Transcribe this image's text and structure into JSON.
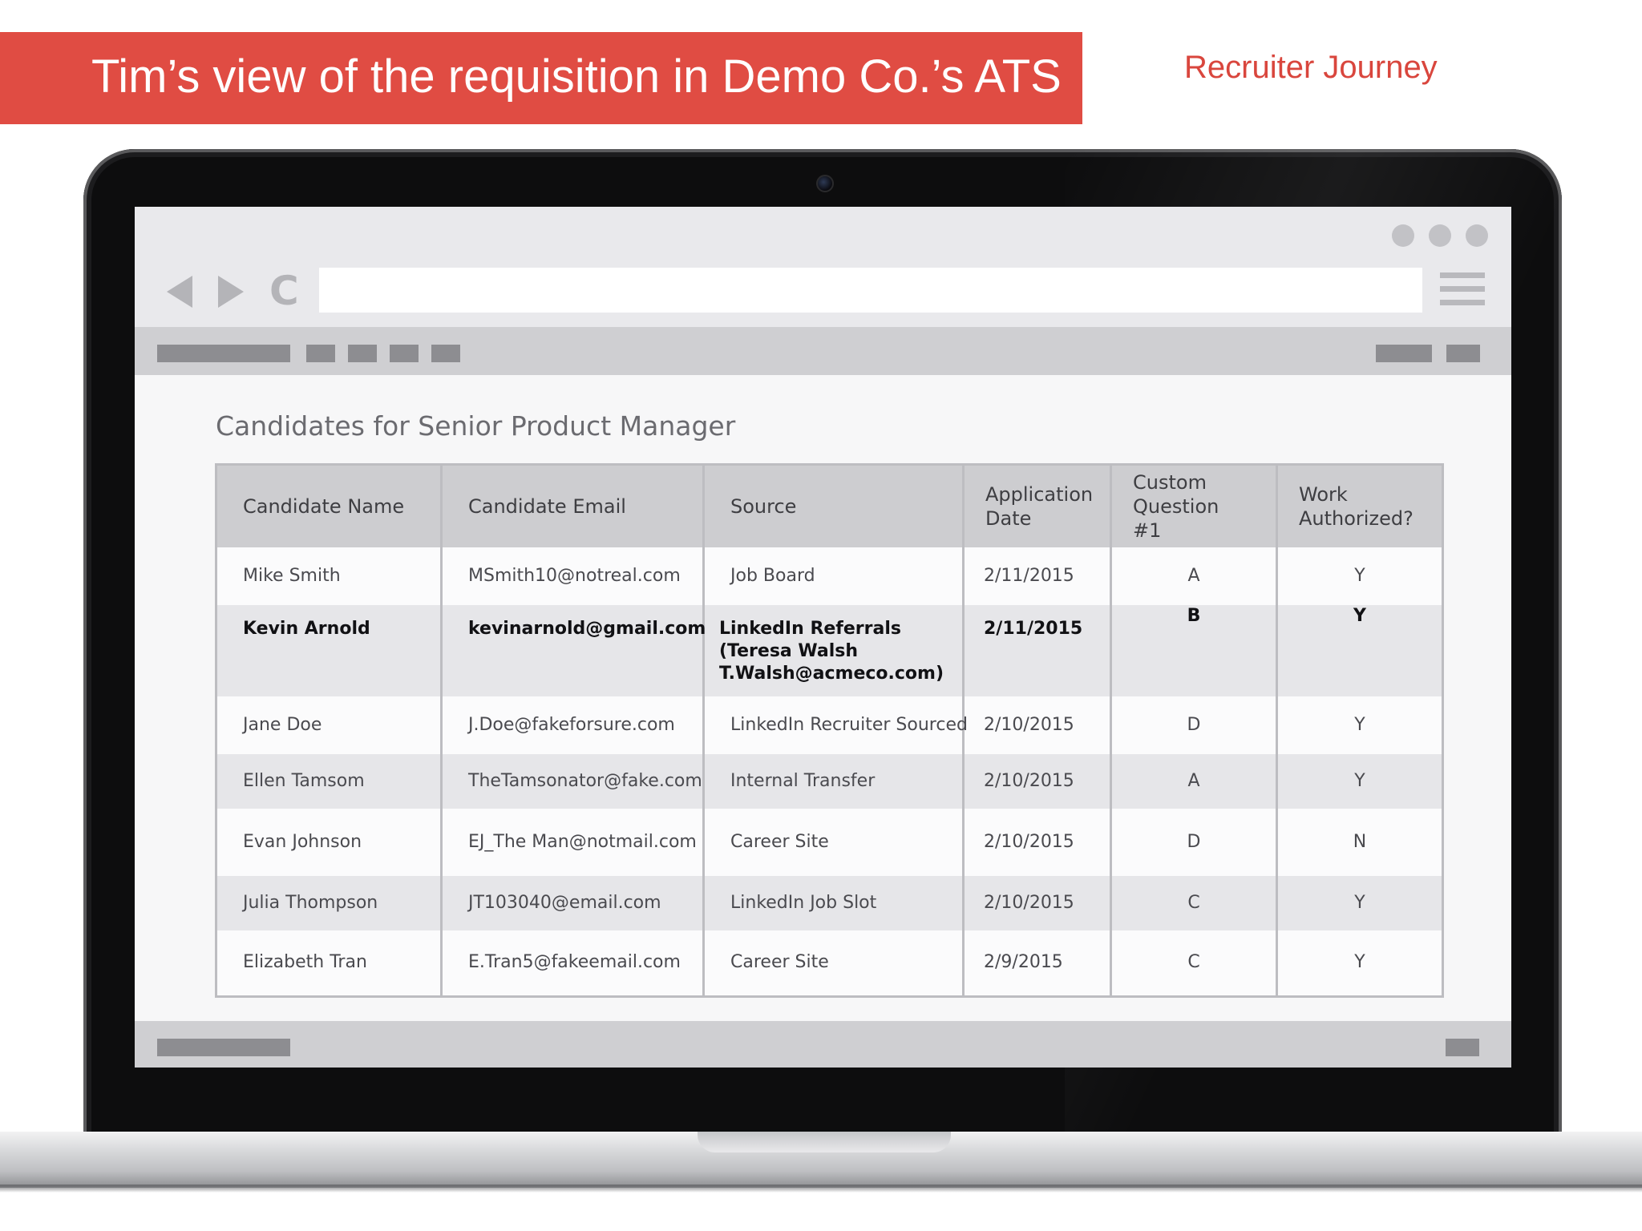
{
  "slide": {
    "title": "Tim’s view of the requisition in Demo Co.’s ATS",
    "subtitle": "Recruiter Journey",
    "accent_color": "#e04c43"
  },
  "browser": {
    "icons": [
      "back-arrow-icon",
      "forward-arrow-icon",
      "reload-icon",
      "hamburger-menu-icon"
    ],
    "reload_glyph": "C"
  },
  "page": {
    "heading": "Candidates for Senior Product Manager",
    "columns": [
      "Candidate Name",
      "Candidate Email",
      "Source",
      "Application Date",
      "Custom Question #1",
      "Work Authorized?"
    ],
    "rows": [
      {
        "name": "Mike Smith",
        "email": "MSmith10@notreal.com",
        "source": "Job Board",
        "date": "2/11/2015",
        "q1": "A",
        "auth": "Y"
      },
      {
        "name": "Kevin Arnold",
        "email": "kevinarnold@gmail.com",
        "source": "LinkedIn Referrals (Teresa Walsh T.Walsh@acmeco.com)",
        "date": "2/11/2015",
        "q1": "B",
        "auth": "Y"
      },
      {
        "name": "Jane Doe",
        "email": "J.Doe@fakeforsure.com",
        "source": "LinkedIn Recruiter Sourced",
        "date": "2/10/2015",
        "q1": "D",
        "auth": "Y"
      },
      {
        "name": "Ellen Tamsom",
        "email": "TheTamsonator@fake.com",
        "source": "Internal Transfer",
        "date": "2/10/2015",
        "q1": "A",
        "auth": "Y"
      },
      {
        "name": "Evan Johnson",
        "email": "EJ_The Man@notmail.com",
        "source": "Career Site",
        "date": "2/10/2015",
        "q1": "D",
        "auth": "N"
      },
      {
        "name": "Julia Thompson",
        "email": "JT103040@email.com",
        "source": "LinkedIn Job Slot",
        "date": "2/10/2015",
        "q1": "C",
        "auth": "Y"
      },
      {
        "name": "Elizabeth Tran",
        "email": "E.Tran5@fakeemail.com",
        "source": "Career Site",
        "date": "2/9/2015",
        "q1": "C",
        "auth": "Y"
      }
    ]
  }
}
